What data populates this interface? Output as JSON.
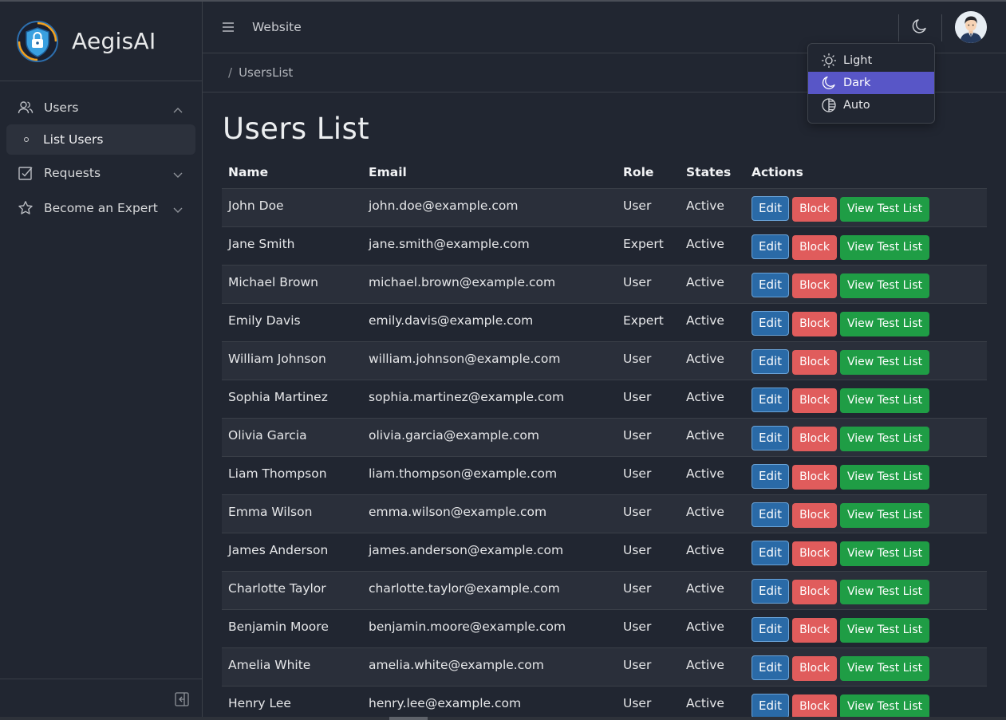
{
  "brand": {
    "name": "AegisAI"
  },
  "sidebar": {
    "items": [
      {
        "label": "Users",
        "icon": "users-icon",
        "expanded": true
      },
      {
        "label": "List Users",
        "icon": "bullet-icon",
        "active": true
      },
      {
        "label": "Requests",
        "icon": "checkbox-icon",
        "expanded": false
      },
      {
        "label": "Become an Expert",
        "icon": "star-icon",
        "expanded": false
      }
    ]
  },
  "header": {
    "link": "Website"
  },
  "breadcrumb": {
    "separator": "/",
    "current": "UsersList"
  },
  "theme_menu": {
    "items": [
      {
        "label": "Light",
        "icon": "sun-icon"
      },
      {
        "label": "Dark",
        "icon": "moon-icon",
        "selected": true
      },
      {
        "label": "Auto",
        "icon": "contrast-icon"
      }
    ],
    "accent": "#5856c7"
  },
  "page": {
    "title": "Users List"
  },
  "table": {
    "columns": [
      "Name",
      "Email",
      "Role",
      "States",
      "Actions"
    ],
    "rows": [
      {
        "name": "John Doe",
        "email": "john.doe@example.com",
        "role": "User",
        "state": "Active"
      },
      {
        "name": "Jane Smith",
        "email": "jane.smith@example.com",
        "role": "Expert",
        "state": "Active"
      },
      {
        "name": "Michael Brown",
        "email": "michael.brown@example.com",
        "role": "User",
        "state": "Active"
      },
      {
        "name": "Emily Davis",
        "email": "emily.davis@example.com",
        "role": "Expert",
        "state": "Active"
      },
      {
        "name": "William Johnson",
        "email": "william.johnson@example.com",
        "role": "User",
        "state": "Active"
      },
      {
        "name": "Sophia Martinez",
        "email": "sophia.martinez@example.com",
        "role": "User",
        "state": "Active"
      },
      {
        "name": "Olivia Garcia",
        "email": "olivia.garcia@example.com",
        "role": "User",
        "state": "Active"
      },
      {
        "name": "Liam Thompson",
        "email": "liam.thompson@example.com",
        "role": "User",
        "state": "Active"
      },
      {
        "name": "Emma Wilson",
        "email": "emma.wilson@example.com",
        "role": "User",
        "state": "Active"
      },
      {
        "name": "James Anderson",
        "email": "james.anderson@example.com",
        "role": "User",
        "state": "Active"
      },
      {
        "name": "Charlotte Taylor",
        "email": "charlotte.taylor@example.com",
        "role": "User",
        "state": "Active"
      },
      {
        "name": "Benjamin Moore",
        "email": "benjamin.moore@example.com",
        "role": "User",
        "state": "Active"
      },
      {
        "name": "Amelia White",
        "email": "amelia.white@example.com",
        "role": "User",
        "state": "Active"
      },
      {
        "name": "Henry Lee",
        "email": "henry.lee@example.com",
        "role": "User",
        "state": "Active"
      }
    ],
    "actions": {
      "edit": "Edit",
      "block": "Block",
      "view": "View Test List"
    }
  },
  "colors": {
    "edit": "#2a6aa7",
    "block": "#e05c5c",
    "view": "#1f9d45",
    "background": "#212631"
  }
}
